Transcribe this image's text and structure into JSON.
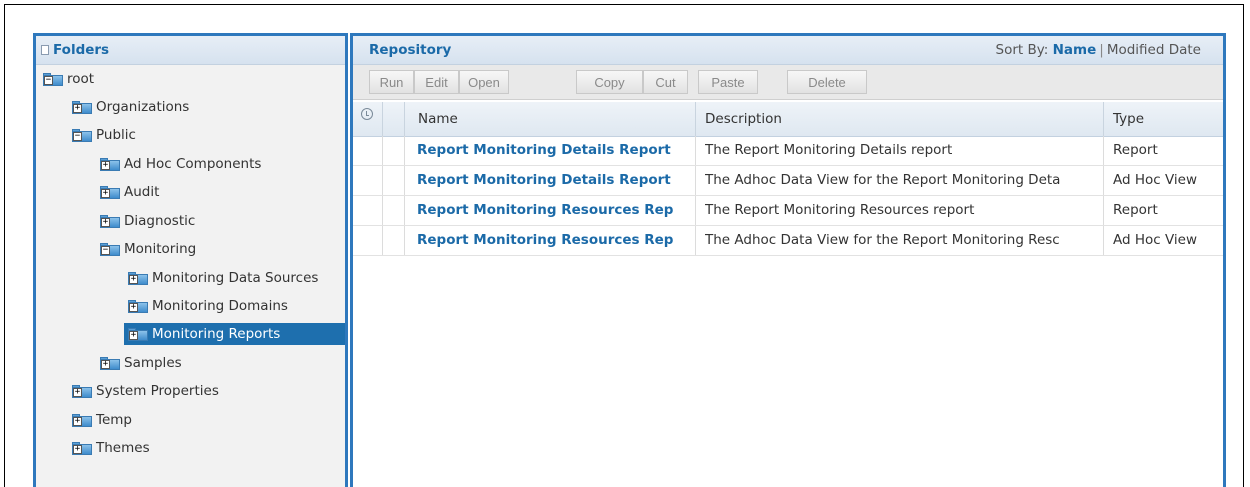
{
  "folders": {
    "title": "Folders",
    "nodes": [
      {
        "label": "root",
        "sign": "−"
      },
      {
        "label": "Organizations",
        "sign": "+"
      },
      {
        "label": "Public",
        "sign": "−"
      },
      {
        "label": "Ad Hoc Components",
        "sign": "+"
      },
      {
        "label": "Audit",
        "sign": "+"
      },
      {
        "label": "Diagnostic",
        "sign": "+"
      },
      {
        "label": "Monitoring",
        "sign": "−"
      },
      {
        "label": "Monitoring Data Sources",
        "sign": "+"
      },
      {
        "label": "Monitoring Domains",
        "sign": "+"
      },
      {
        "label": "Monitoring Reports",
        "sign": "+",
        "selected": true
      },
      {
        "label": "Samples",
        "sign": "+"
      },
      {
        "label": "System Properties",
        "sign": "+"
      },
      {
        "label": "Temp",
        "sign": "+"
      },
      {
        "label": "Themes",
        "sign": "+"
      }
    ]
  },
  "repository": {
    "title": "Repository",
    "sort_by_label": "Sort By:",
    "sort_name": "Name",
    "sort_modified": "Modified Date",
    "toolbar": {
      "run": "Run",
      "edit": "Edit",
      "open": "Open",
      "copy": "Copy",
      "cut": "Cut",
      "paste": "Paste",
      "delete": "Delete"
    },
    "columns": {
      "name": "Name",
      "description": "Description",
      "type": "Type"
    },
    "rows": [
      {
        "name": "Report Monitoring Details Report",
        "description": "The Report Monitoring Details report",
        "type": "Report"
      },
      {
        "name": "Report Monitoring Details Report",
        "description": "The Adhoc Data View for the Report Monitoring Deta",
        "type": "Ad Hoc View"
      },
      {
        "name": "Report Monitoring Resources Rep",
        "description": "The Report Monitoring Resources report",
        "type": "Report"
      },
      {
        "name": "Report Monitoring Resources Rep",
        "description": "The Adhoc Data View for the Report Monitoring Resc",
        "type": "Ad Hoc View"
      }
    ]
  },
  "colors": {
    "accent": "#2e78bd",
    "selected": "#1e6fae",
    "link": "#1b6aa8"
  }
}
